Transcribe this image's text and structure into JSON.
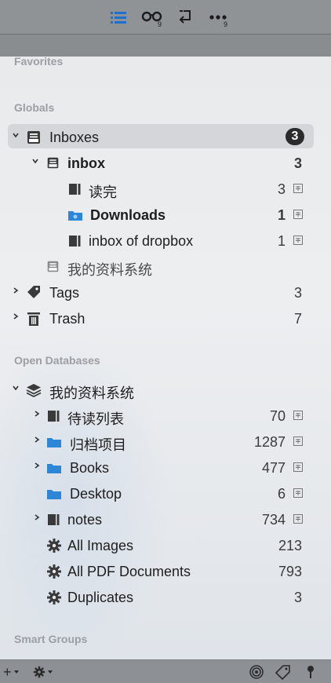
{
  "toolbar": {
    "icons": [
      "list-view-icon",
      "glasses-icon",
      "return-arrow-icon",
      "more-icon"
    ],
    "glasses_badge": "9",
    "more_badge": "9"
  },
  "sections": {
    "favorites": "Favorites",
    "globals": "Globals",
    "open_databases": "Open Databases",
    "smart_groups": "Smart Groups"
  },
  "globals": {
    "inboxes": {
      "label": "Inboxes",
      "count": "3"
    },
    "inbox": {
      "label": "inbox",
      "count": "3"
    },
    "read_done": {
      "label": "读完",
      "count": "3"
    },
    "downloads": {
      "label": "Downloads",
      "count": "1"
    },
    "inbox_dropbox": {
      "label": "inbox of dropbox",
      "count": "1"
    },
    "my_db": {
      "label": "我的资料系统"
    },
    "tags": {
      "label": "Tags",
      "count": "3"
    },
    "trash": {
      "label": "Trash",
      "count": "7"
    }
  },
  "databases": {
    "db": {
      "label": "我的资料系统"
    },
    "to_read": {
      "label": "待读列表",
      "count": "70"
    },
    "archive": {
      "label": "归档项目",
      "count": "1287"
    },
    "books": {
      "label": "Books",
      "count": "477"
    },
    "desktop": {
      "label": "Desktop",
      "count": "6"
    },
    "notes": {
      "label": "notes",
      "count": "734"
    },
    "all_images": {
      "label": "All Images",
      "count": "213"
    },
    "all_pdf": {
      "label": "All PDF Documents",
      "count": "793"
    },
    "duplicates": {
      "label": "Duplicates",
      "count": "3"
    }
  },
  "colors": {
    "folder_blue": "#2d86d6",
    "selection": "#d2d4d7",
    "badge_bg": "#2b2b2b"
  }
}
